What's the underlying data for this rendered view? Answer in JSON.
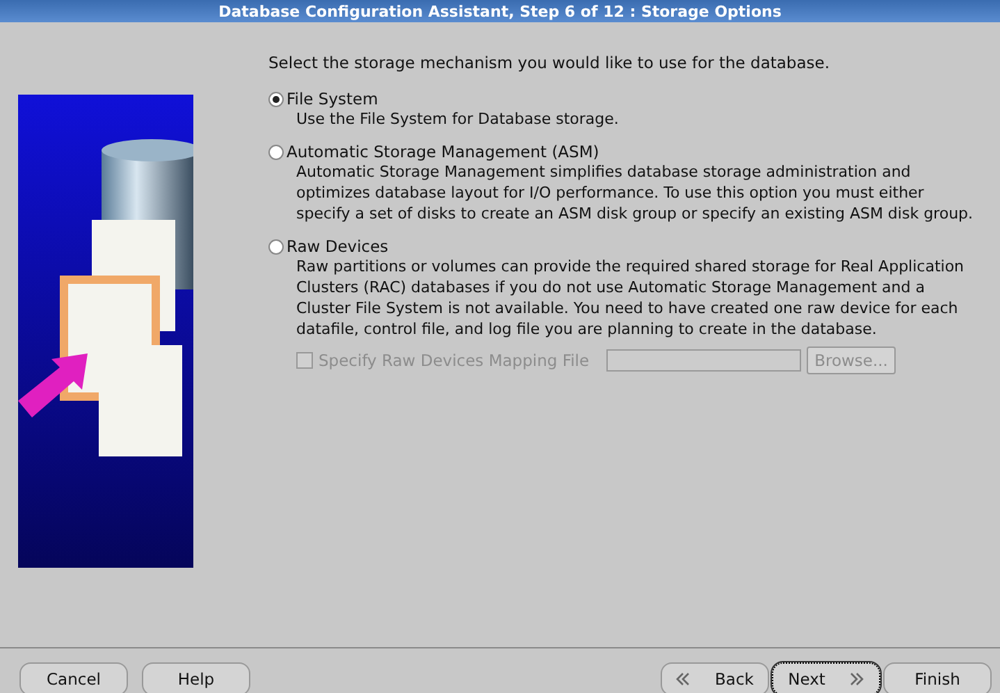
{
  "window": {
    "title": "Database Configuration Assistant, Step 6 of 12 : Storage Options"
  },
  "prompt": "Select the storage mechanism you would like to use for the database.",
  "options": [
    {
      "label": "File System",
      "description": "Use the File System for Database storage.",
      "selected": true
    },
    {
      "label": "Automatic Storage Management (ASM)",
      "description": "Automatic Storage Management simplifies database storage administration and optimizes database layout for I/O performance. To use this option you must either specify a set of disks to create an ASM disk group or specify an existing ASM disk group.",
      "selected": false
    },
    {
      "label": "Raw Devices",
      "description": "Raw partitions or volumes can provide the required shared storage for Real Application Clusters (RAC) databases if you do not use Automatic Storage Management and a Cluster File System is not available.  You need to have created one raw device for each datafile, control file, and log file you are planning to create in the database.",
      "selected": false
    }
  ],
  "mapping": {
    "label": "Specify Raw Devices Mapping File",
    "checked": false,
    "disabled": true,
    "browse": "Browse..."
  },
  "buttons_left": [
    "Cancel",
    "Help"
  ],
  "buttons_right": [
    {
      "label": "Back",
      "kind": "back",
      "focused": false
    },
    {
      "label": "Next",
      "kind": "next",
      "focused": true
    },
    {
      "label": "Finish",
      "kind": "finish",
      "focused": false
    }
  ]
}
